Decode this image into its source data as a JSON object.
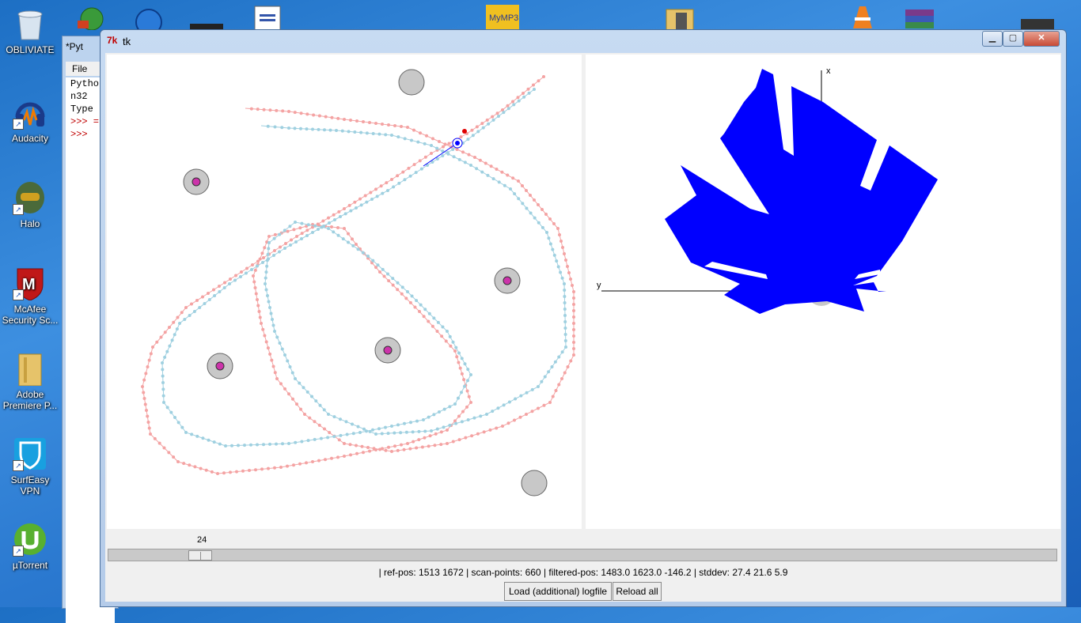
{
  "desktop": {
    "icons": [
      {
        "label": "OBLIVIATE",
        "icon": "recycle-bin-icon"
      },
      {
        "label": "Audacity",
        "icon": "headphones-icon"
      },
      {
        "label": "Halo",
        "icon": "helmet-icon"
      },
      {
        "label": "McAfee Security Sc...",
        "icon": "mcafee-shield-icon"
      },
      {
        "label": "Adobe Premiere P...",
        "icon": "folder-icon"
      },
      {
        "label": "SurfEasy VPN",
        "icon": "vpn-shield-icon"
      },
      {
        "label": "µTorrent",
        "icon": "utorrent-icon"
      }
    ]
  },
  "shell": {
    "title": "*Pyt",
    "menu_file": "File",
    "lines": [
      "Pytho",
      "n32",
      "Type"
    ],
    "prompts": [
      ">>> =",
      ">>>"
    ]
  },
  "tk": {
    "title": "tk",
    "minimize": "▁",
    "maximize": "▢",
    "close": "✕"
  },
  "right_canvas": {
    "axis_x_label": "x",
    "axis_y_label": "y",
    "scan_color": "#0000ff"
  },
  "colors": {
    "ref_path": "#f4a3a3",
    "filtered_path": "#9fd0e0",
    "landmark_fill": "#c8c8c8",
    "detected_landmark": "#cc33aa",
    "robot": "#0000ff",
    "ref_robot": "#e00000"
  },
  "slider": {
    "value": "24"
  },
  "status": "| ref-pos: 1513 1672 | scan-points: 660 | filtered-pos: 1483.0 1623.0 -146.2 | stddev: 27.4 21.6 5.9",
  "buttons": {
    "load": "Load (additional) logfile",
    "reload": "Reload all"
  }
}
